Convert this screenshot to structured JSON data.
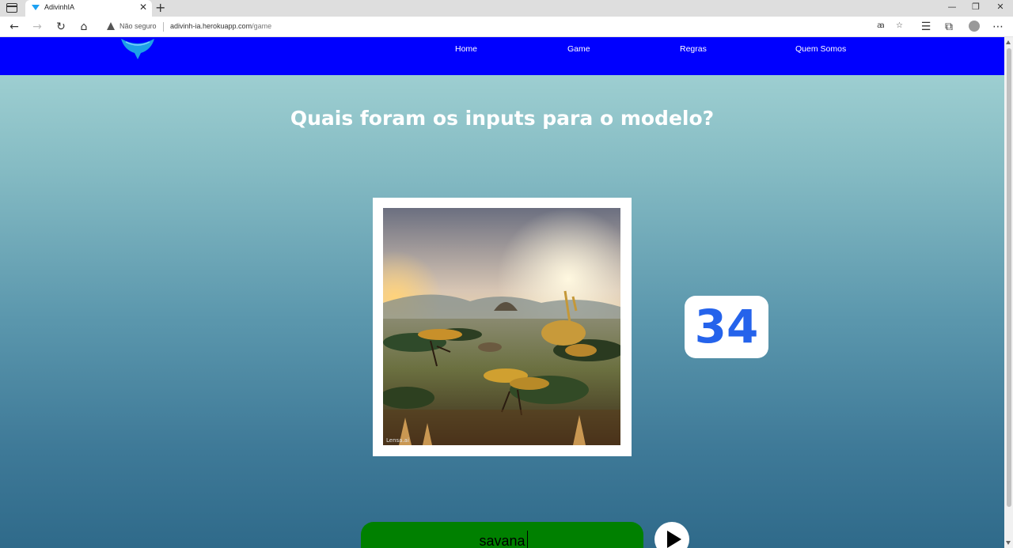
{
  "browser": {
    "tab_title": "AdivinhIA",
    "security_label": "Não seguro",
    "url_host": "adivinh-ia.herokuapp.com",
    "url_path": "/game",
    "window_controls": {
      "minimize": "—",
      "restore": "❐",
      "close": "✕"
    },
    "tab_close": "✕",
    "new_tab": "+"
  },
  "nav": {
    "links": [
      {
        "label": "Home"
      },
      {
        "label": "Game"
      },
      {
        "label": "Regras"
      },
      {
        "label": "Quem Somos"
      }
    ]
  },
  "game": {
    "heading": "Quais foram os inputs para o modelo?",
    "counter": "34",
    "guess_value": "savana",
    "image_watermark": "Lensa.ai"
  },
  "colors": {
    "navbar": "#0000ff",
    "counter_text": "#2563eb",
    "input_bg": "#008000"
  }
}
